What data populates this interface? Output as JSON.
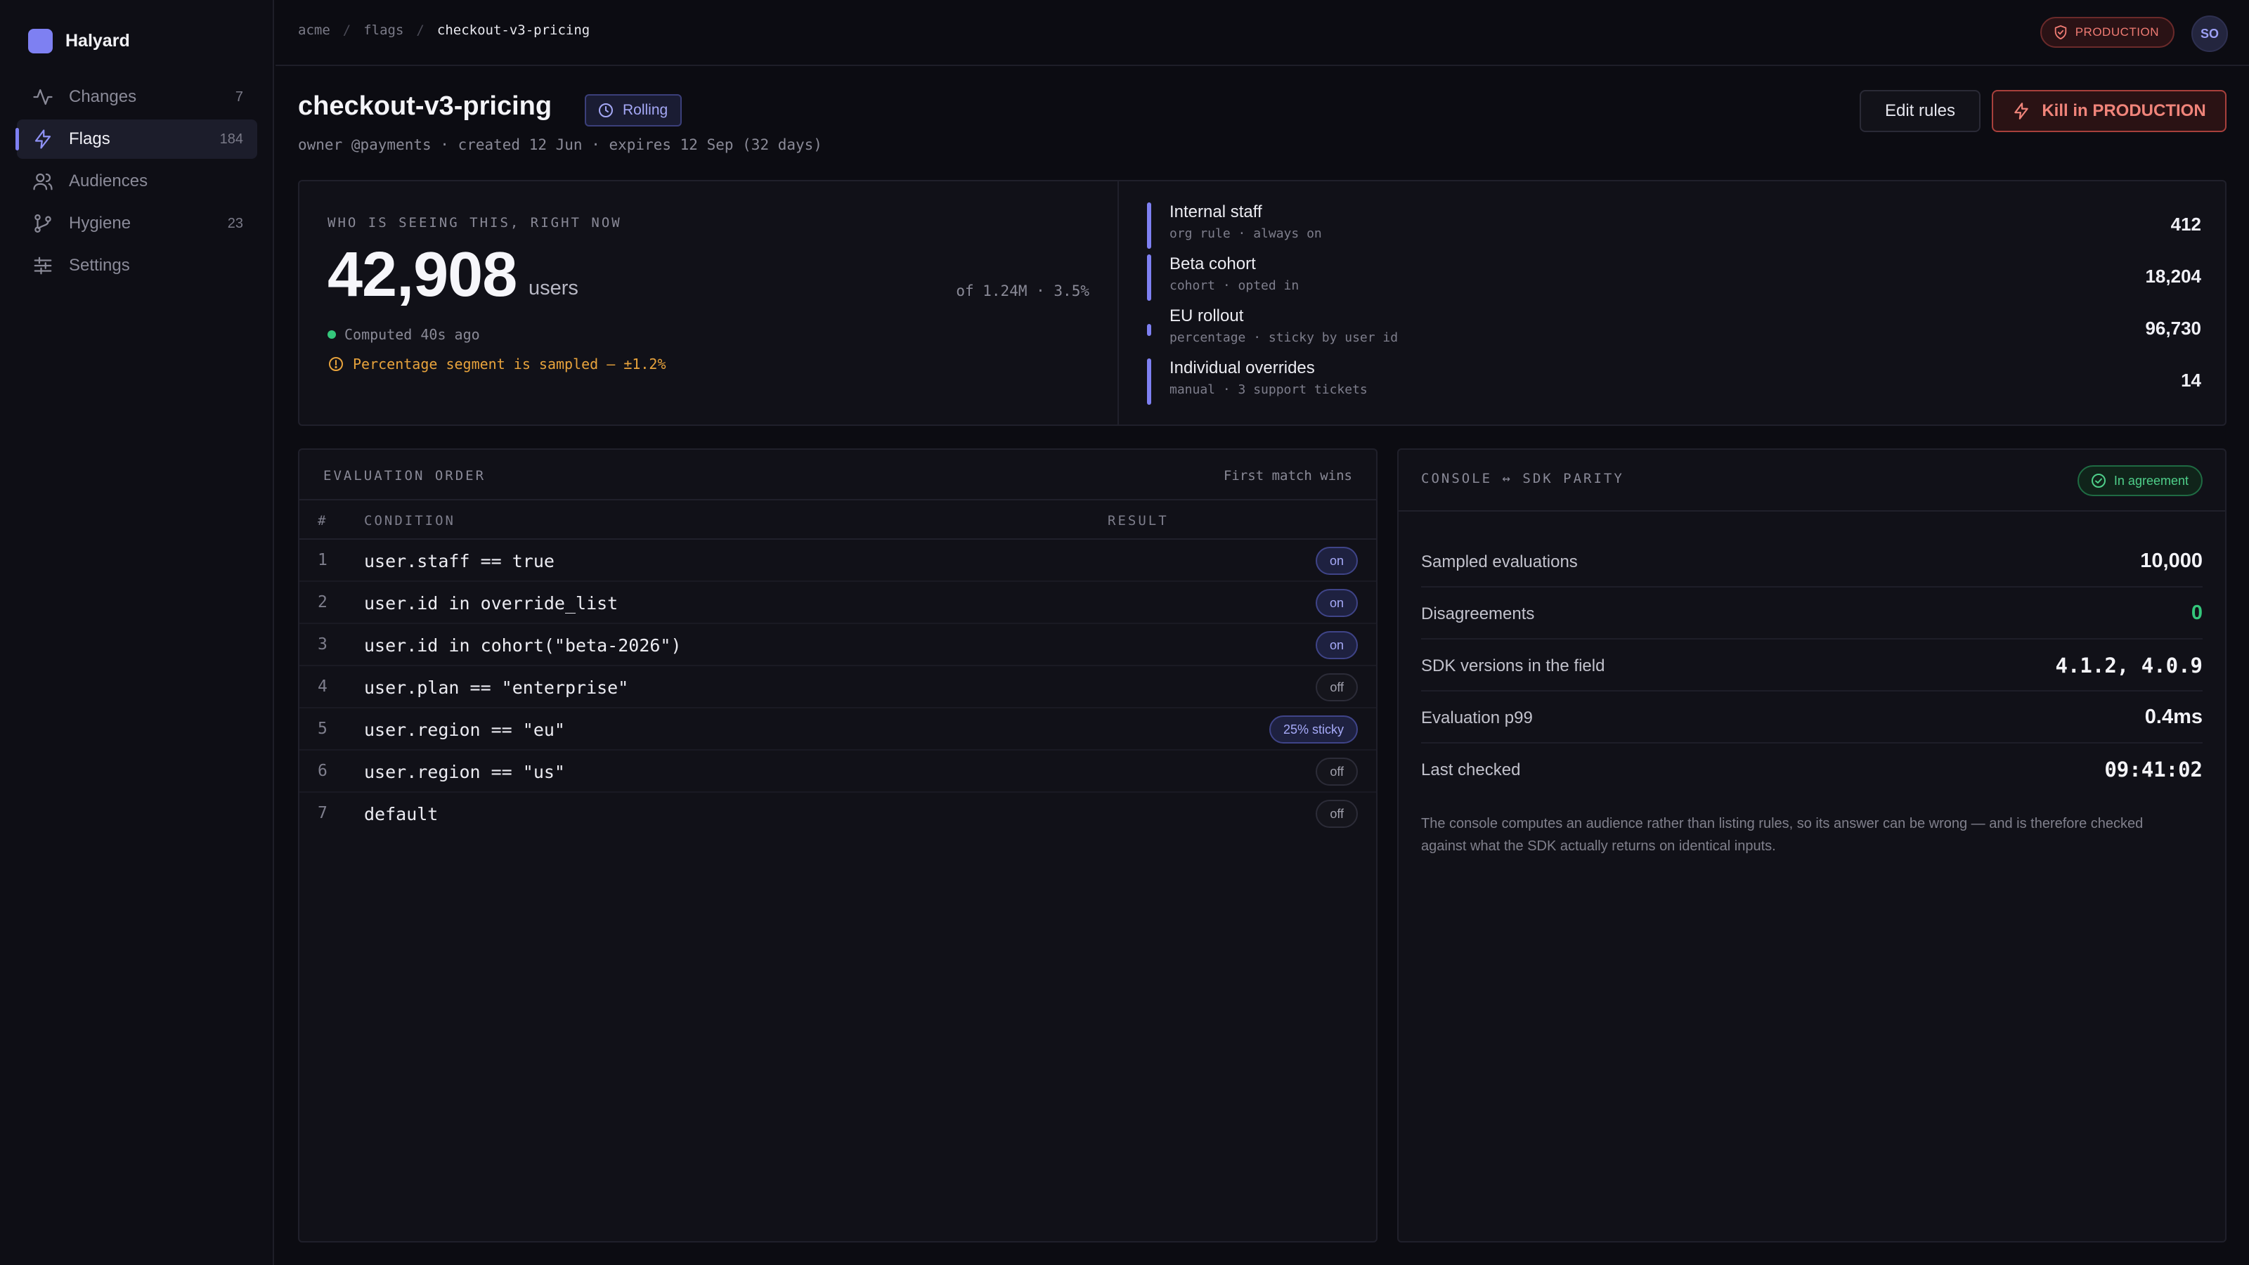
{
  "app": {
    "name": "Halyard"
  },
  "sidebar": {
    "items": [
      {
        "label": "Changes",
        "count": "7",
        "icon": "activity-icon"
      },
      {
        "label": "Flags",
        "count": "184",
        "icon": "lightning-icon",
        "active": true
      },
      {
        "label": "Audiences",
        "count": "",
        "icon": "users-icon"
      },
      {
        "label": "Hygiene",
        "count": "23",
        "icon": "branch-icon"
      },
      {
        "label": "Settings",
        "count": "",
        "icon": "sliders-icon"
      }
    ]
  },
  "topbar": {
    "breadcrumbs": [
      "acme",
      "flags",
      "checkout-v3-pricing"
    ],
    "environment": "PRODUCTION",
    "avatar_initials": "SO"
  },
  "header": {
    "title": "checkout-v3-pricing",
    "status": "Rolling",
    "meta": "owner @payments · created 12 Jun · expires 12 Sep (32 days)",
    "edit_label": "Edit rules",
    "kill_label": "Kill in PRODUCTION"
  },
  "audience": {
    "kicker": "WHO IS SEEING THIS, RIGHT NOW",
    "count": "42,908",
    "unit": "users",
    "of_total": "of 1.24M · 3.5%",
    "computed": "Computed 40s ago",
    "warning": "Percentage segment is sampled — ±1.2%",
    "segments": [
      {
        "name": "Internal staff",
        "sub": "org rule · always on",
        "value": "412",
        "bar": 1.0
      },
      {
        "name": "Beta cohort",
        "sub": "cohort · opted in",
        "value": "18,204",
        "bar": 1.0
      },
      {
        "name": "EU rollout",
        "sub": "percentage · sticky by user id",
        "value": "96,730",
        "bar": 0.25
      },
      {
        "name": "Individual overrides",
        "sub": "manual · 3 support tickets",
        "value": "14",
        "bar": 1.0
      }
    ]
  },
  "evaluation": {
    "kicker": "EVALUATION ORDER",
    "note": "First match wins",
    "columns": [
      "#",
      "CONDITION",
      "RESULT"
    ],
    "rows": [
      {
        "n": "1",
        "condition": "user.staff == true",
        "result": "on",
        "kind": "on"
      },
      {
        "n": "2",
        "condition": "user.id in override_list",
        "result": "on",
        "kind": "on"
      },
      {
        "n": "3",
        "condition": "user.id in cohort(\"beta-2026\")",
        "result": "on",
        "kind": "on"
      },
      {
        "n": "4",
        "condition": "user.plan == \"enterprise\"",
        "result": "off",
        "kind": "off"
      },
      {
        "n": "5",
        "condition": "user.region == \"eu\"",
        "result": "25% sticky",
        "kind": "sticky"
      },
      {
        "n": "6",
        "condition": "user.region == \"us\"",
        "result": "off",
        "kind": "off"
      },
      {
        "n": "7",
        "condition": "default",
        "result": "off",
        "kind": "off"
      }
    ]
  },
  "parity": {
    "kicker": "CONSOLE ↔ SDK PARITY",
    "status": "In agreement",
    "stats": [
      {
        "label": "Sampled evaluations",
        "value": "10,000"
      },
      {
        "label": "Disagreements",
        "value": "0",
        "accent": "#34c77b"
      },
      {
        "label": "SDK versions in the field",
        "value": "4.1.2, 4.0.9",
        "mono": true
      },
      {
        "label": "Evaluation p99",
        "value": "0.4ms"
      },
      {
        "label": "Last checked",
        "value": "09:41:02",
        "mono": true
      }
    ],
    "note": "The console computes an audience rather than listing rules, so its answer can be wrong — and is therefore checked against what the SDK actually returns on identical inputs."
  },
  "colors": {
    "accent": "#7e80f2",
    "danger": "#ef7b73",
    "success": "#34c77b",
    "warning": "#e8a33c",
    "background": "#0c0c12"
  }
}
